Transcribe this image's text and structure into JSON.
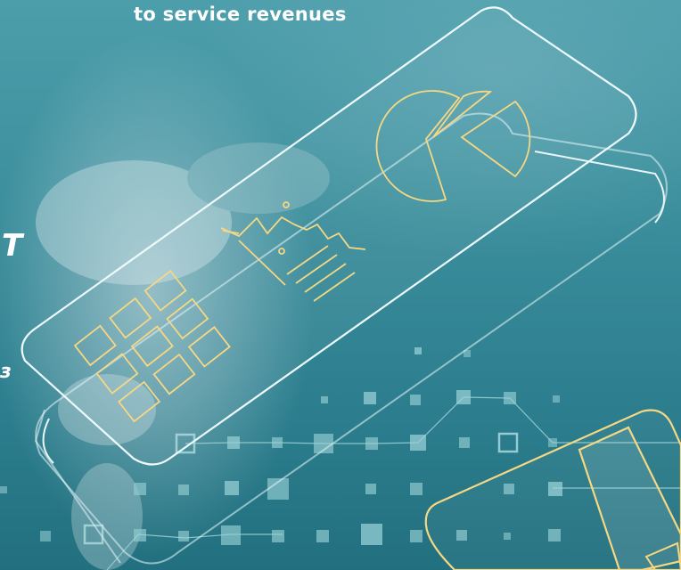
{
  "headline": "to service revenues",
  "side_text": {
    "letter_1": "T",
    "letter_2": "з"
  },
  "colors": {
    "background": "#3c8f9d",
    "outline_white": "#e8f6f7",
    "outline_gold": "#f6d783",
    "tile_light": "#9fd2d6"
  },
  "icons": [
    "smartphone-outline",
    "keypad-icon",
    "line-chart-icon",
    "pie-chart-icon",
    "credit-card-icon",
    "data-grid-pattern"
  ]
}
